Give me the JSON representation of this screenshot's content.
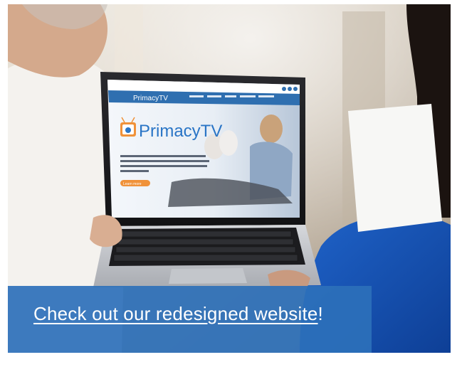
{
  "laptop_site": {
    "logo_text": "PrimacyTV",
    "hero_logo_text": "PrimacyTV",
    "hero_cta_label": "Learn more"
  },
  "banner": {
    "link_text": "Check out our redesigned website",
    "suffix": "!"
  },
  "colors": {
    "banner_bg": "#2c70ba",
    "site_header": "#2f6fb0",
    "site_accent": "#f0923a",
    "site_logo_blue": "#2a75c6"
  }
}
